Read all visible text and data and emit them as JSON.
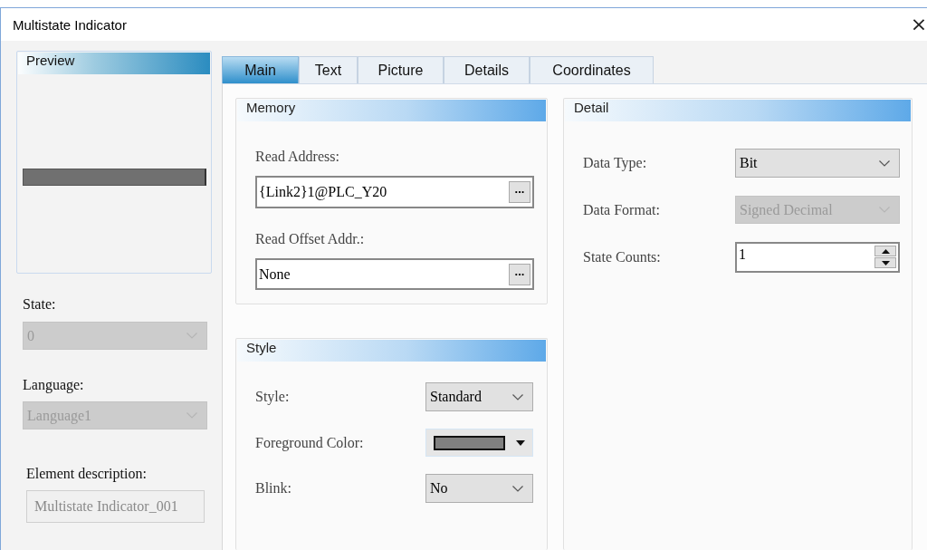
{
  "window": {
    "title": "Multistate Indicator",
    "close": "×"
  },
  "preview": {
    "title": "Preview"
  },
  "left_fields": [
    {
      "kind": "select",
      "label": "State:",
      "value": "0",
      "disabled": true
    },
    {
      "kind": "select",
      "label": "Language:",
      "value": "Language1",
      "disabled": true
    },
    {
      "kind": "text",
      "label": "Element description:",
      "value": "Multistate Indicator_001",
      "disabled": true
    }
  ],
  "tabs": [
    {
      "label": "Main",
      "selected": true
    },
    {
      "label": "Text",
      "selected": false
    },
    {
      "label": "Picture",
      "selected": false
    },
    {
      "label": "Details",
      "selected": false
    },
    {
      "label": "Coordinates",
      "selected": false
    }
  ],
  "memory": {
    "title": "Memory",
    "fields": [
      {
        "label": "Read Address:",
        "value": "{Link2}1@PLC_Y20",
        "button": "..."
      },
      {
        "label": "Read Offset Addr.:",
        "value": "None",
        "button": "..."
      }
    ]
  },
  "style": {
    "title": "Style",
    "rows": [
      {
        "kind": "select",
        "label": "Style:",
        "value": "Standard",
        "disabled": false
      },
      {
        "kind": "color",
        "label": "Foreground Color:",
        "color": "#808080"
      },
      {
        "kind": "select",
        "label": "Blink:",
        "value": "No",
        "disabled": false
      }
    ]
  },
  "detail": {
    "title": "Detail",
    "rows": [
      {
        "kind": "select",
        "label": "Data Type:",
        "value": "Bit",
        "disabled": false
      },
      {
        "kind": "select",
        "label": "Data Format:",
        "value": "Signed Decimal",
        "disabled": true
      },
      {
        "kind": "spin",
        "label": "State Counts:",
        "value": "1"
      }
    ]
  }
}
